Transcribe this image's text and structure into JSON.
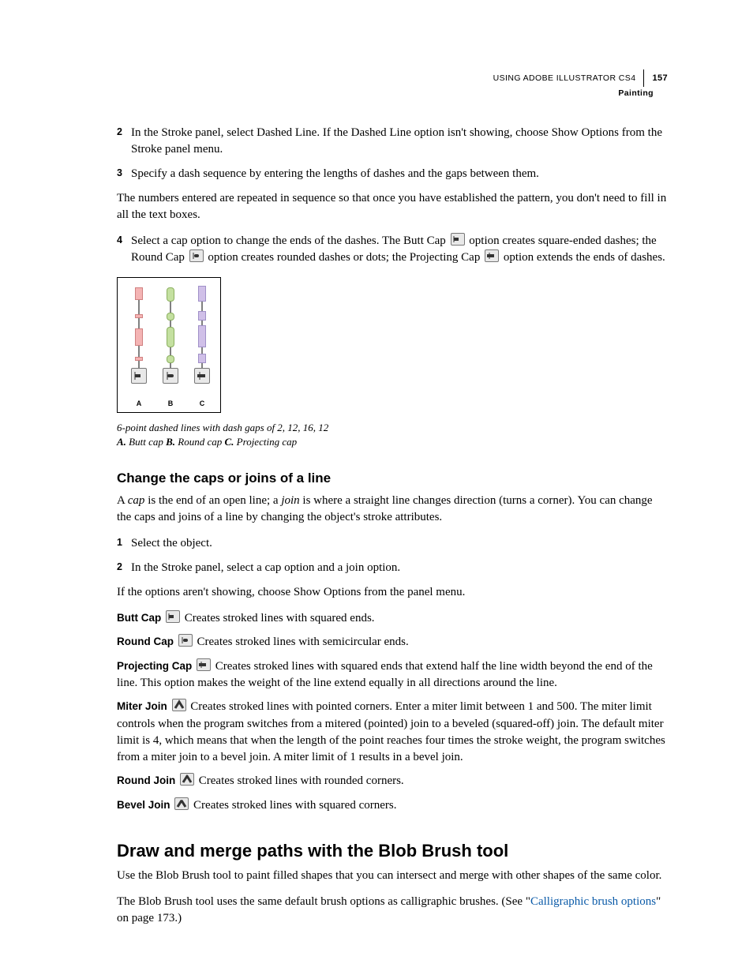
{
  "header": {
    "breadcrumb": "USING ADOBE ILLUSTRATOR CS4",
    "pagenum": "157",
    "section": "Painting"
  },
  "steps_a": [
    {
      "n": "2",
      "text": "In the Stroke panel, select Dashed Line. If the Dashed Line option isn't showing, choose Show Options from the Stroke panel menu."
    },
    {
      "n": "3",
      "text": "Specify a dash sequence by entering the lengths of dashes and the gaps between them."
    }
  ],
  "para_repeat": "The numbers entered are repeated in sequence so that once you have established the pattern, you don't need to fill in all the text boxes.",
  "step4": {
    "n": "4",
    "pre": "Select a cap option to change the ends of the dashes. The Butt Cap ",
    "mid1": " option creates square-ended dashes; the Round Cap ",
    "mid2": " option creates rounded dashes or dots; the Projecting Cap ",
    "post": " option extends the ends of dashes."
  },
  "figure": {
    "labels": [
      "A",
      "B",
      "C"
    ],
    "caption_line1": "6-point dashed lines with dash gaps of 2, 12, 16, 12",
    "caption_a_label": "A.",
    "caption_a": " Butt cap  ",
    "caption_b_label": "B.",
    "caption_b": " Round cap  ",
    "caption_c_label": "C.",
    "caption_c": " Projecting cap"
  },
  "h3_caps": "Change the caps or joins of a line",
  "caps_intro_pre": "A ",
  "caps_intro_em1": "cap",
  "caps_intro_mid": " is the end of an open line; a ",
  "caps_intro_em2": "join",
  "caps_intro_post": " is where a straight line changes direction (turns a corner). You can change the caps and joins of a line by changing the object's stroke attributes.",
  "steps_b": [
    {
      "n": "1",
      "text": "Select the object."
    },
    {
      "n": "2",
      "text": "In the Stroke panel, select a cap option and a join option."
    }
  ],
  "para_options": "If the options aren't showing, choose Show Options from the panel menu.",
  "defs": [
    {
      "term": "Butt Cap",
      "icon": "butt",
      "text": "Creates stroked lines with squared ends."
    },
    {
      "term": "Round Cap",
      "icon": "round",
      "text": "Creates stroked lines with semicircular ends."
    },
    {
      "term": "Projecting Cap",
      "icon": "proj",
      "text": "Creates stroked lines with squared ends that extend half the line width beyond the end of the line. This option makes the weight of the line extend equally in all directions around the line."
    },
    {
      "term": "Miter Join",
      "icon": "miter",
      "text": "Creates stroked lines with pointed corners. Enter a miter limit between 1 and 500. The miter limit controls when the program switches from a mitered (pointed) join to a beveled (squared-off) join. The default miter limit is 4, which means that when the length of the point reaches four times the stroke weight, the program switches from a miter join to a bevel join. A miter limit of 1 results in a bevel join."
    },
    {
      "term": "Round Join",
      "icon": "roundj",
      "text": "Creates stroked lines with rounded corners."
    },
    {
      "term": "Bevel Join",
      "icon": "bevelj",
      "text": "Creates stroked lines with squared corners."
    }
  ],
  "h2_blob": "Draw and merge paths with the Blob Brush tool",
  "blob_p1": "Use the Blob Brush tool to paint filled shapes that you can intersect and merge with other shapes of the same color.",
  "blob_p2_pre": "The Blob Brush tool uses the same default brush options as calligraphic brushes. (See \"",
  "blob_link": "Calligraphic brush options",
  "blob_p2_post": "\" on page 173.)"
}
